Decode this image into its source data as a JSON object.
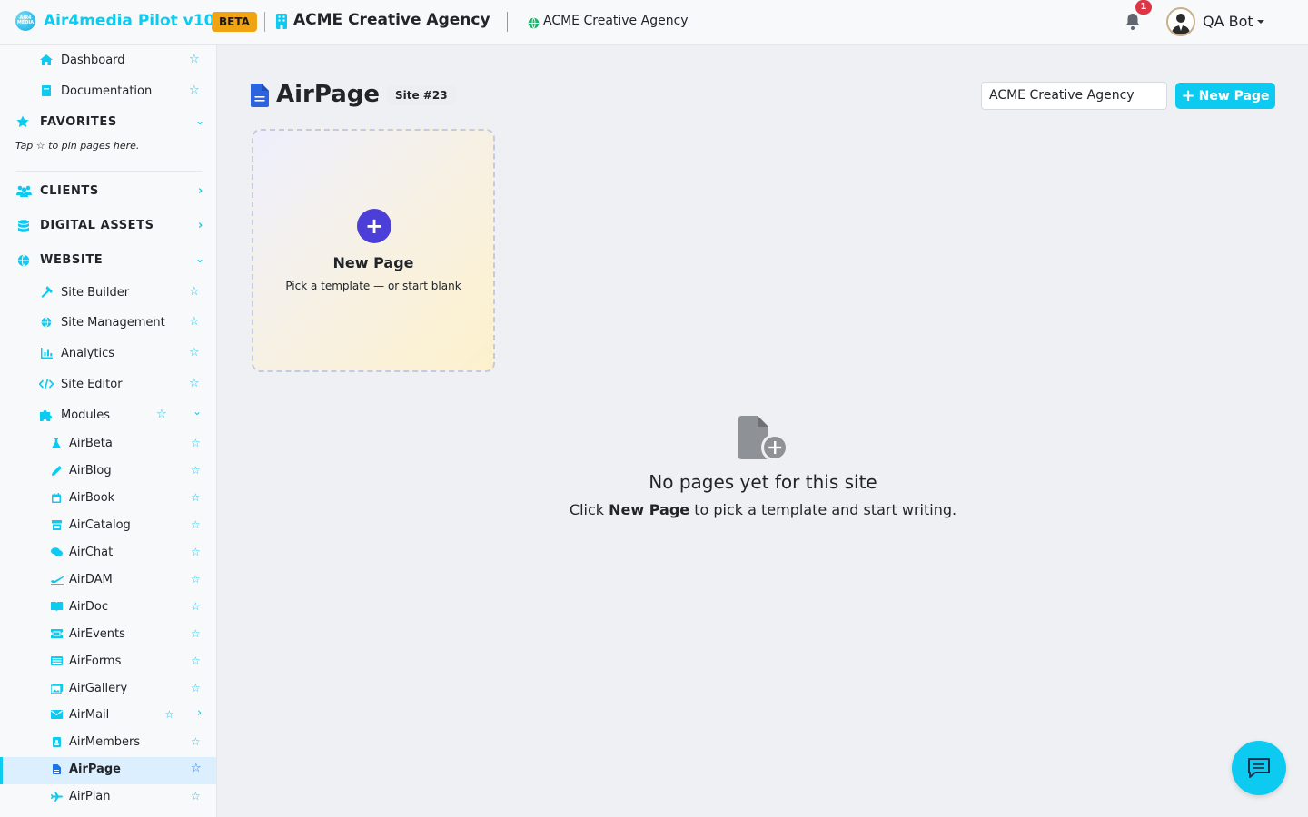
{
  "topbar": {
    "logo_text": "AIR4 MEDIA",
    "brand": "Air4media Pilot v10",
    "beta": "BETA",
    "agency": "ACME Creative Agency",
    "site_name": "ACME Creative Agency",
    "notifications": "1",
    "user": "QA Bot"
  },
  "sidebar": {
    "dashboard": "Dashboard",
    "documentation": "Documentation",
    "favorites": "FAVORITES",
    "favorites_hint": "Tap ☆ to pin pages here.",
    "clients": "CLIENTS",
    "digital_assets": "DIGITAL ASSETS",
    "website": "WEBSITE",
    "website_items": [
      "Site Builder",
      "Site Management",
      "Analytics",
      "Site Editor",
      "Modules"
    ],
    "modules": [
      "AirBeta",
      "AirBlog",
      "AirBook",
      "AirCatalog",
      "AirChat",
      "AirDAM",
      "AirDoc",
      "AirEvents",
      "AirForms",
      "AirGallery",
      "AirMail",
      "AirMembers",
      "AirPage",
      "AirPlan"
    ],
    "active_module": "AirPage"
  },
  "main": {
    "title": "AirPage",
    "site_badge": "Site #23",
    "site_select_value": "ACME Creative Agency",
    "new_button": "New Page",
    "card": {
      "title": "New Page",
      "subtitle": "Pick a template — or start blank"
    },
    "empty": {
      "title": "No pages yet for this site",
      "sub_before": "Click ",
      "sub_bold": "New Page",
      "sub_after": " to pick a template and start writing."
    }
  },
  "colors": {
    "accent": "#0dcaf0",
    "beta": "#f0a414",
    "primary_purple": "#4b3fd8",
    "notification": "#dc3545"
  }
}
